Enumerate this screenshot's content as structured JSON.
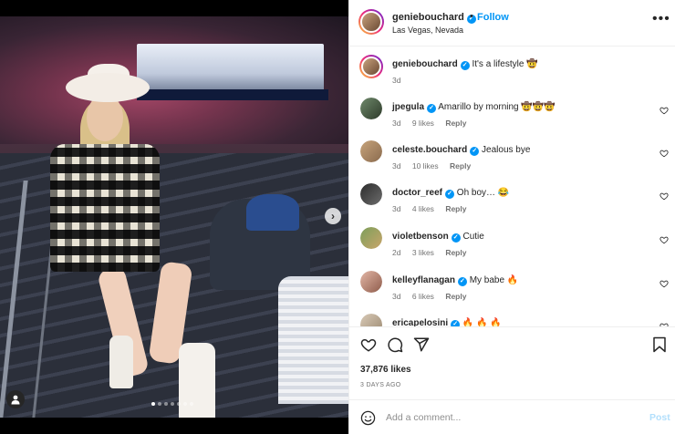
{
  "post": {
    "author": "geniebouchard",
    "follow_label": "Follow",
    "location": "Las Vegas, Nevada",
    "more_icon": "more-options-icon",
    "caption": "It's a lifestyle 🤠",
    "caption_age": "3d",
    "carousel": {
      "slides": 7,
      "active_index": 0
    }
  },
  "comments": [
    {
      "user": "jpegula",
      "text": "Amarillo by morning 🤠🤠🤠",
      "age": "3d",
      "likes": "9 likes",
      "reply": "Reply"
    },
    {
      "user": "celeste.bouchard",
      "text": "Jealous bye",
      "age": "3d",
      "likes": "10 likes",
      "reply": "Reply"
    },
    {
      "user": "doctor_reef",
      "text": "Oh boy… 😂",
      "age": "3d",
      "likes": "4 likes",
      "reply": "Reply"
    },
    {
      "user": "violetbenson",
      "text": "Cutie",
      "age": "2d",
      "likes": "3 likes",
      "reply": "Reply"
    },
    {
      "user": "kelleyflanagan",
      "text": "My babe 🔥",
      "age": "3d",
      "likes": "6 likes",
      "reply": "Reply"
    },
    {
      "user": "ericapelosini",
      "text": "🔥 🔥 🔥",
      "age": "",
      "likes": "",
      "reply": ""
    }
  ],
  "stats": {
    "likes": "37,876 likes",
    "time_ago": "3 DAYS AGO"
  },
  "add_comment": {
    "placeholder": "Add a comment...",
    "post_label": "Post"
  },
  "colors": {
    "accent": "#0095f6",
    "text": "#262626",
    "muted": "#737373",
    "post_disabled": "#b2dffc"
  }
}
